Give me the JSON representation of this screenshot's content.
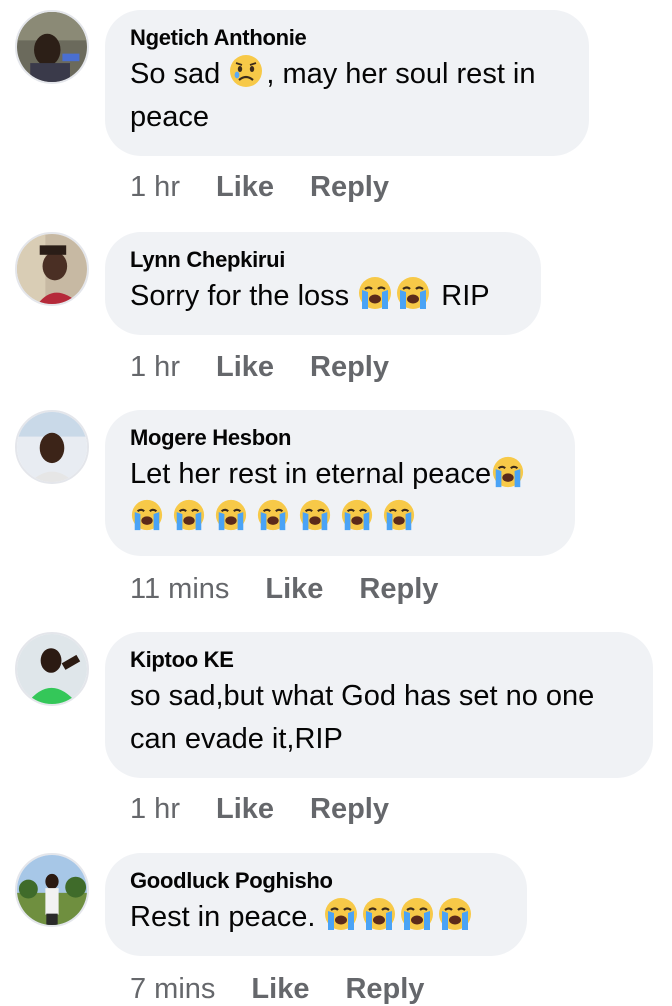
{
  "comments": [
    {
      "author": "Ngetich Anthonie",
      "text_before": "So sad ",
      "emoji": [
        "sad-but-relieved-face"
      ],
      "text_after": ", may her soul rest in peace",
      "time": "1 hr",
      "like": "Like",
      "reply": "Reply"
    },
    {
      "author": "Lynn Chepkirui",
      "text_before": "Sorry for the loss ",
      "emoji": [
        "loudly-crying-face",
        "loudly-crying-face"
      ],
      "text_after": " RIP",
      "time": "1 hr",
      "like": "Like",
      "reply": "Reply"
    },
    {
      "author": "Mogere Hesbon",
      "text_before": "Let her rest in eternal peace",
      "emoji": [
        "loudly-crying-face",
        "loudly-crying-face",
        "loudly-crying-face",
        "loudly-crying-face",
        "loudly-crying-face",
        "loudly-crying-face",
        "loudly-crying-face",
        "loudly-crying-face"
      ],
      "text_after": "",
      "time": "11 mins",
      "like": "Like",
      "reply": "Reply"
    },
    {
      "author": "Kiptoo KE",
      "text_before": "so sad,but what God has set no one can evade it,RIP",
      "emoji": [],
      "text_after": "",
      "time": "1 hr",
      "like": "Like",
      "reply": "Reply"
    },
    {
      "author": "Goodluck Poghisho",
      "text_before": "Rest in peace. ",
      "emoji": [
        "loudly-crying-face",
        "loudly-crying-face",
        "loudly-crying-face",
        "loudly-crying-face"
      ],
      "text_after": "",
      "time": "7 mins",
      "like": "Like",
      "reply": "Reply"
    }
  ],
  "colors": {
    "bubble": "#f0f2f5",
    "text": "#050505",
    "secondary": "#65676b"
  }
}
